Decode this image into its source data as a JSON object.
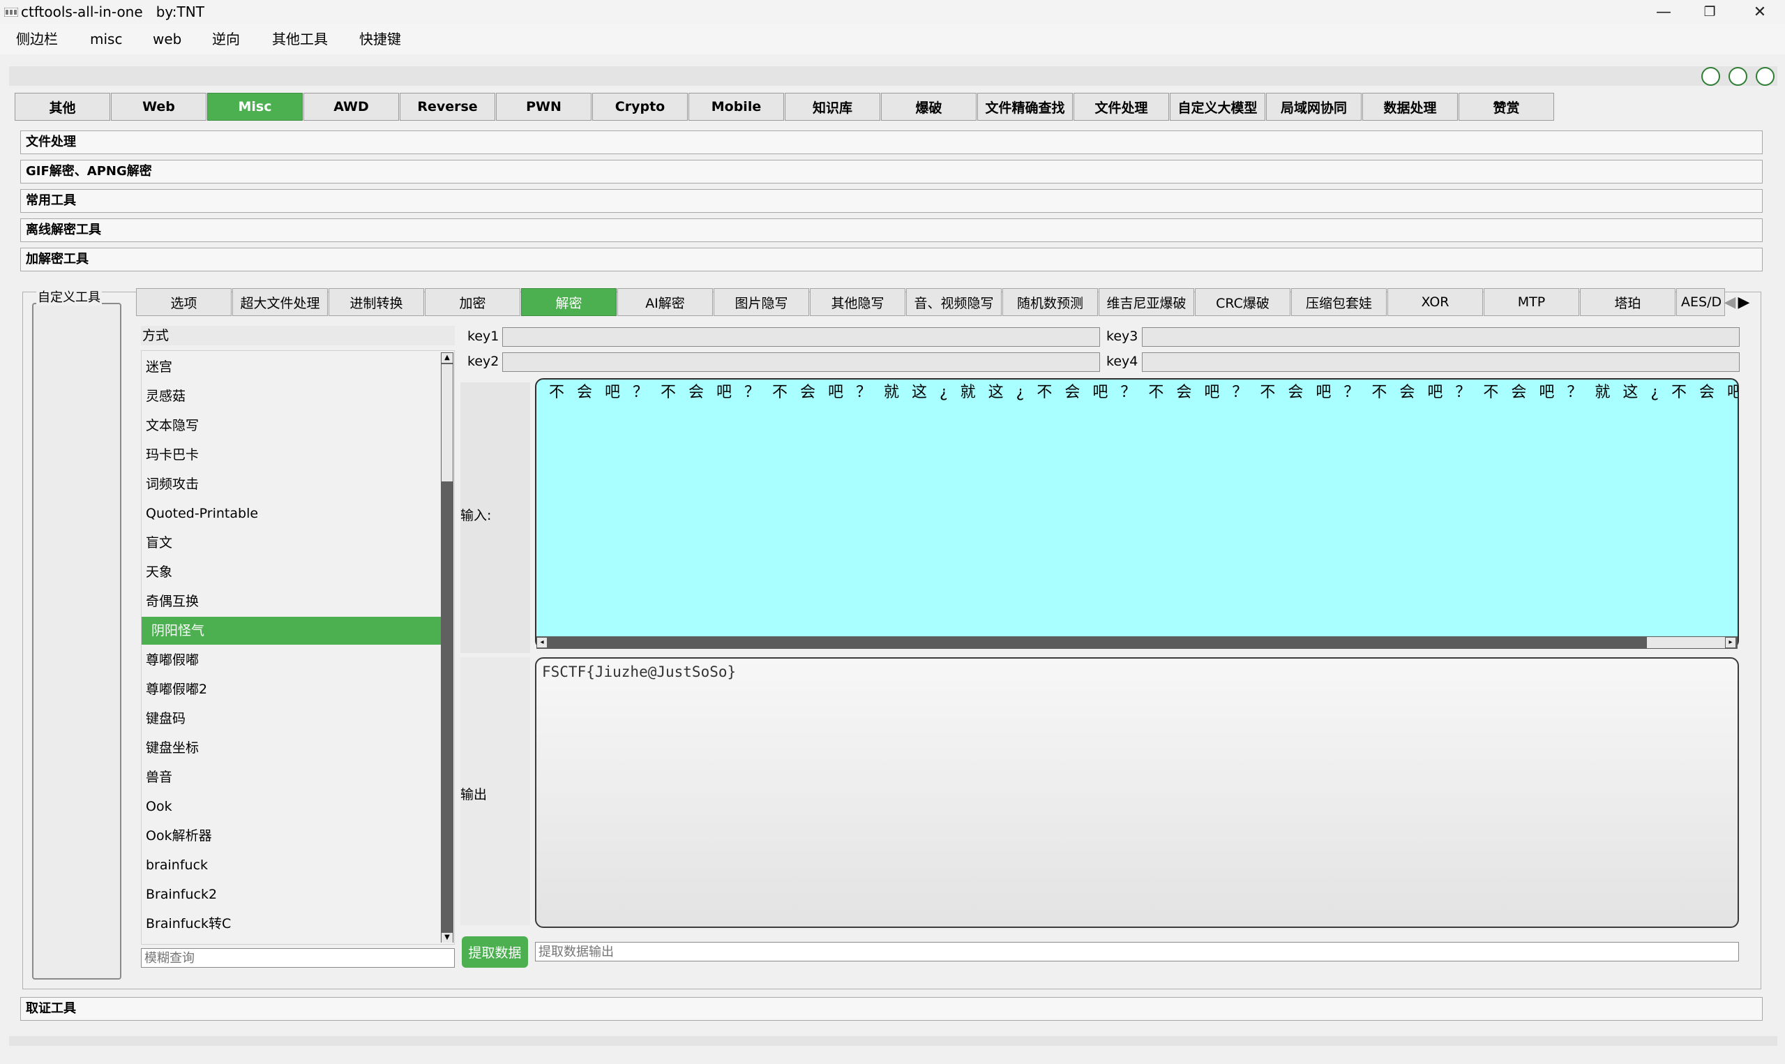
{
  "window": {
    "title": "ctftools-all-in-one   by:TNT",
    "controls": {
      "minimize": "—",
      "restore": "❐",
      "close": "✕"
    }
  },
  "menubar": {
    "items": [
      "侧边栏",
      "misc",
      "web",
      "逆向",
      "其他工具",
      "快捷键"
    ]
  },
  "main_tabs": {
    "items": [
      "其他",
      "Web",
      "Misc",
      "AWD",
      "Reverse",
      "PWN",
      "Crypto",
      "Mobile",
      "知识库",
      "爆破",
      "文件精确查找",
      "文件处理",
      "自定义大模型",
      "局域网协同",
      "数据处理",
      "赞赏"
    ],
    "active": "Misc"
  },
  "sections": {
    "items": [
      "文件处理",
      "GIF解密、APNG解密",
      "常用工具",
      "离线解密工具",
      "加解密工具"
    ],
    "bottom": "取证工具"
  },
  "custom_group": {
    "label": "自定义工具"
  },
  "sub_tabs": {
    "items": [
      "选项",
      "超大文件处理",
      "进制转换",
      "加密",
      "解密",
      "AI解密",
      "图片隐写",
      "其他隐写",
      "音、视频隐写",
      "随机数预测",
      "维吉尼亚爆破",
      "CRC爆破",
      "压缩包套娃",
      "XOR",
      "MTP",
      "塔珀",
      "AES/D"
    ],
    "active": "解密",
    "arrows": {
      "left": "◀",
      "right": "▶"
    }
  },
  "methods": {
    "header": "方式",
    "items": [
      "迷宫",
      "灵感菇",
      "文本隐写",
      "玛卡巴卡",
      "词频攻击",
      "Quoted-Printable",
      "盲文",
      "天象",
      "奇偶互换",
      "阴阳怪气",
      "尊嘟假嘟",
      "尊嘟假嘟2",
      "键盘码",
      "键盘坐标",
      "兽音",
      "Ook",
      "Ook解析器",
      "brainfuck",
      "Brainfuck2",
      "Brainfuck转C"
    ],
    "selected": "阴阳怪气",
    "filter_placeholder": "模糊查询"
  },
  "keys": {
    "key1": "key1",
    "key2": "key2",
    "key3": "key3",
    "key4": "key4",
    "values": {
      "key1": "",
      "key2": "",
      "key3": "",
      "key4": ""
    }
  },
  "input": {
    "label": "输入:",
    "value": "不会吧？不会吧？不会吧？就这¿就这¿不会吧？不会吧？不会吧？不会吧？不会吧？就这¿不会吧？"
  },
  "output": {
    "label": "输出",
    "value": "FSCTF{Jiuzhe@JustSoSo}"
  },
  "extract": {
    "button": "提取数据",
    "placeholder": "提取数据输出"
  },
  "colors": {
    "accent": "#4caf50",
    "input_bg": "#a9ffff"
  }
}
